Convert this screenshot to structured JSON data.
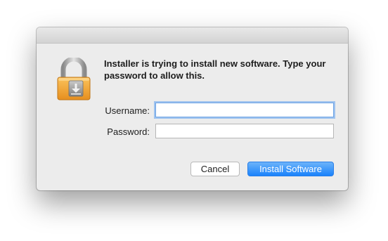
{
  "dialog": {
    "message": "Installer is trying to install new software. Type your password to allow this.",
    "username_label": "Username:",
    "password_label": "Password:",
    "username_value": "",
    "password_value": "",
    "cancel_label": "Cancel",
    "install_label": "Install Software",
    "icon": "lock-icon",
    "accent_color": "#1a82fb",
    "lock_color": "#f5a53a"
  }
}
